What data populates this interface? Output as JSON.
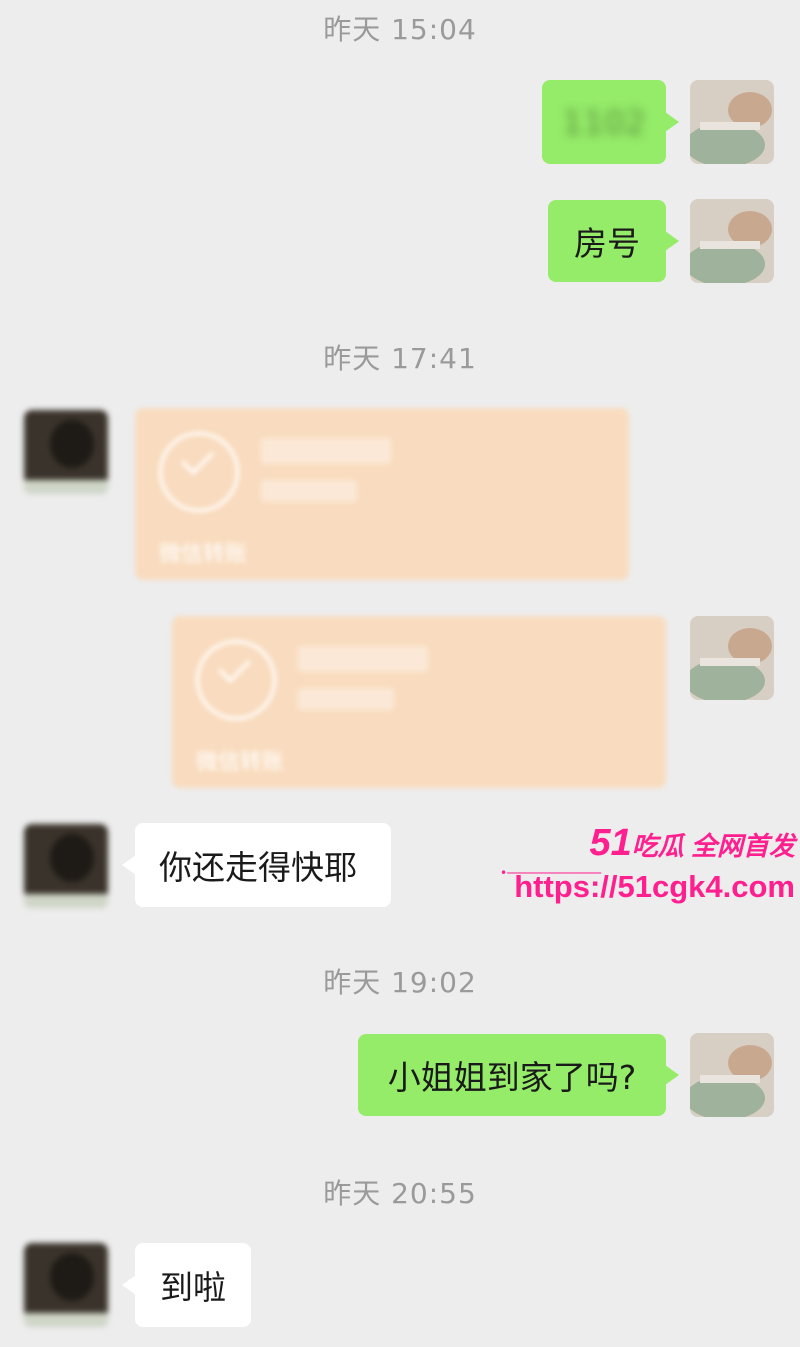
{
  "timestamps": [
    "昨天 15:04",
    "昨天 17:41",
    "昨天 19:02",
    "昨天 20:55"
  ],
  "messages": {
    "m1": "1102",
    "m2": "房号",
    "m3": "你还走得快耶",
    "m4": "小姐姐到家了吗?",
    "m5": "到啦"
  },
  "transfers": [
    {
      "label": "微信转账"
    },
    {
      "label": "微信转账"
    }
  ],
  "watermark": {
    "brand_number": "51",
    "brand_text": "吃瓜 全网首发",
    "url": "https://51cgk4.com"
  },
  "colors": {
    "self_bubble": "#95ec69",
    "other_bubble": "#ffffff",
    "transfer_card": "#f9dcbf",
    "watermark": "#ff1f8e",
    "background": "#ededed"
  }
}
